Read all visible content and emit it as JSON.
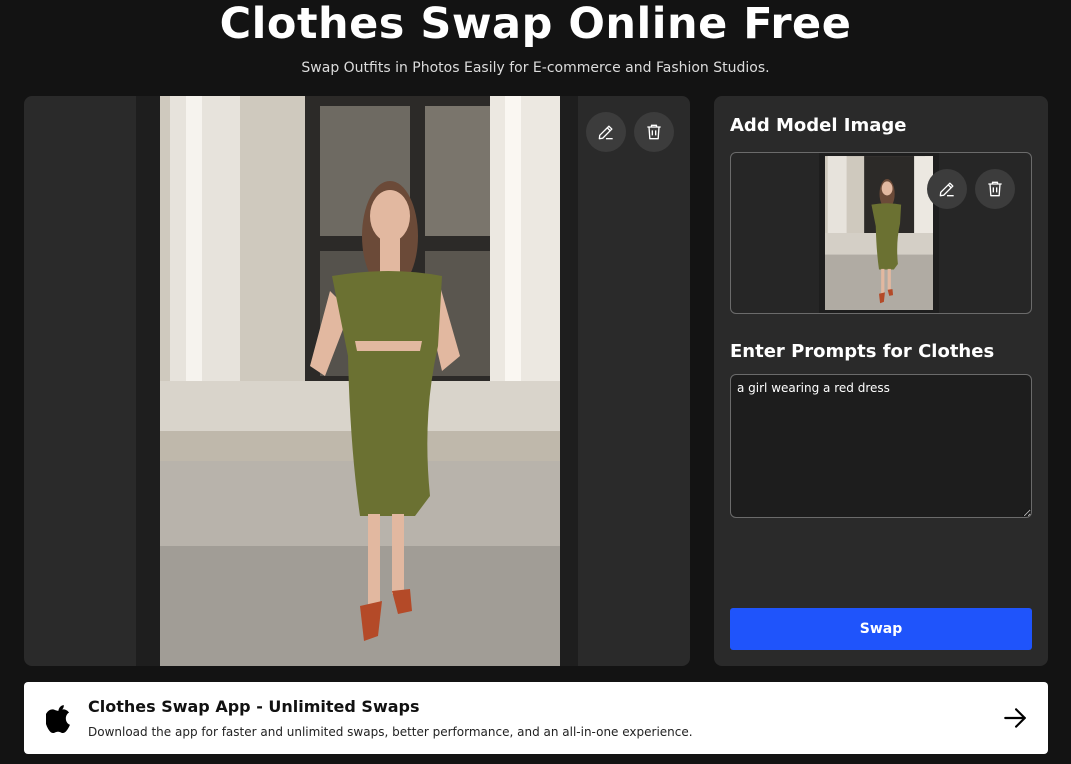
{
  "header": {
    "title": "Clothes Swap Online Free",
    "subtitle": "Swap Outfits in Photos Easily for E-commerce and Fashion Studios."
  },
  "preview": {
    "image_icon": "photo-placeholder",
    "edit_icon": "pencil-icon",
    "delete_icon": "trash-icon"
  },
  "model_section": {
    "title": "Add Model Image",
    "edit_icon": "pencil-icon",
    "delete_icon": "trash-icon"
  },
  "prompt_section": {
    "title": "Enter Prompts for Clothes",
    "value": "a girl wearing a red dress"
  },
  "swap_button": {
    "label": "Swap",
    "color": "#1f54fb"
  },
  "app_banner": {
    "title": "Clothes Swap App - Unlimited Swaps",
    "description": "Download the app for faster and unlimited swaps, better performance, and an all-in-one experience.",
    "logo_icon": "apple-icon",
    "arrow_icon": "arrow-right-icon"
  }
}
